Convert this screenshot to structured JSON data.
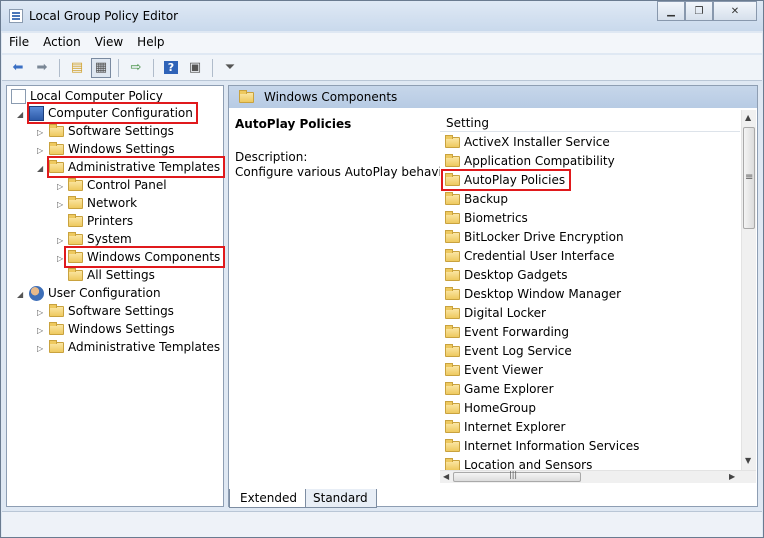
{
  "window": {
    "title": "Local Group Policy Editor"
  },
  "menu": [
    "File",
    "Action",
    "View",
    "Help"
  ],
  "tree": {
    "root": "Local Computer Policy",
    "computer_config": "Computer Configuration",
    "cc_software": "Software Settings",
    "cc_windows": "Windows Settings",
    "cc_admin": "Administrative Templates",
    "control_panel": "Control Panel",
    "network": "Network",
    "printers": "Printers",
    "system": "System",
    "windows_components": "Windows Components",
    "all_settings": "All Settings",
    "user_config": "User Configuration",
    "uc_software": "Software Settings",
    "uc_windows": "Windows Settings",
    "uc_admin": "Administrative Templates"
  },
  "right": {
    "header": "Windows Components",
    "selected_title": "AutoPlay Policies",
    "description_label": "Description:",
    "description_text": "Configure various AutoPlay behaviors."
  },
  "list": {
    "column": "Setting",
    "items": [
      "ActiveX Installer Service",
      "Application Compatibility",
      "AutoPlay Policies",
      "Backup",
      "Biometrics",
      "BitLocker Drive Encryption",
      "Credential User Interface",
      "Desktop Gadgets",
      "Desktop Window Manager",
      "Digital Locker",
      "Event Forwarding",
      "Event Log Service",
      "Event Viewer",
      "Game Explorer",
      "HomeGroup",
      "Internet Explorer",
      "Internet Information Services",
      "Location and Sensors"
    ]
  },
  "tabs": [
    "Extended",
    "Standard"
  ],
  "colors": {
    "highlight": "#e0191c",
    "header_bg": "#c6d6ea"
  }
}
